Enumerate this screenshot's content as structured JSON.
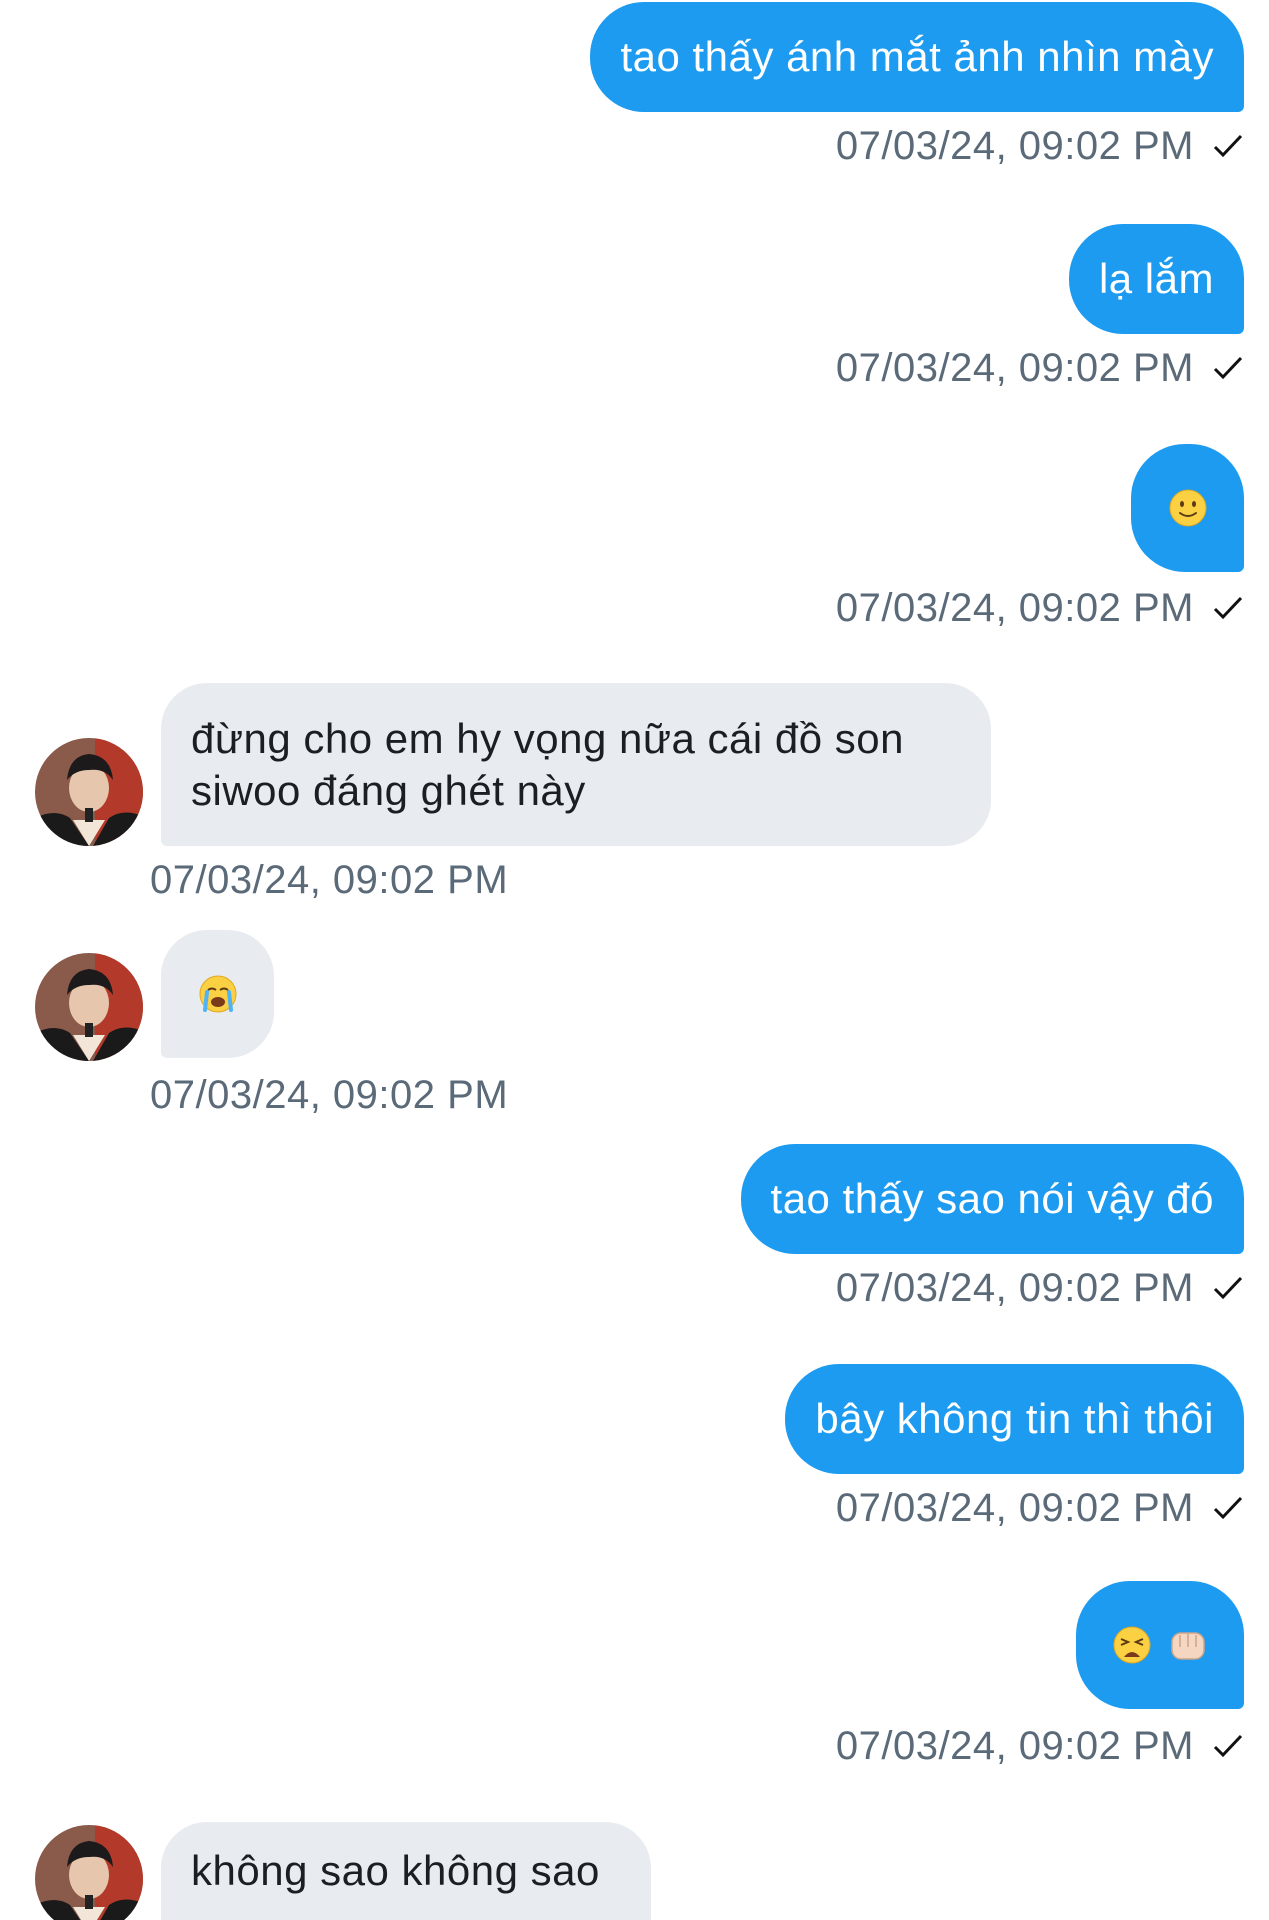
{
  "colors": {
    "outgoing_bubble": "#1d9bf0",
    "incoming_bubble": "#e8ebef",
    "timestamp": "#5b6a78"
  },
  "messages": [
    {
      "direction": "out",
      "text": "tao thấy ánh mắt ảnh nhìn mày",
      "timestamp": "07/03/24, 09:02 PM",
      "read_icon": "check-icon"
    },
    {
      "direction": "out",
      "text": "lạ lắm",
      "timestamp": "07/03/24, 09:02 PM",
      "read_icon": "check-icon"
    },
    {
      "direction": "out",
      "emoji": "slightly-smiling-face-emoji",
      "timestamp": "07/03/24, 09:02 PM",
      "read_icon": "check-icon"
    },
    {
      "direction": "in",
      "text_line1": "đừng cho em hy vọng nữa cái đồ son",
      "text_line2": "siwoo đáng ghét này",
      "timestamp": "07/03/24, 09:02 PM"
    },
    {
      "direction": "in",
      "emoji": "loudly-crying-face-emoji",
      "timestamp": "07/03/24, 09:02 PM"
    },
    {
      "direction": "out",
      "text": "tao thấy sao nói vậy đó",
      "timestamp": "07/03/24, 09:02 PM",
      "read_icon": "check-icon"
    },
    {
      "direction": "out",
      "text": "bây không tin thì thôi",
      "timestamp": "07/03/24, 09:02 PM",
      "read_icon": "check-icon"
    },
    {
      "direction": "out",
      "emoji": "weary-face-and-fist-emoji",
      "timestamp": "07/03/24, 09:02 PM",
      "read_icon": "check-icon"
    },
    {
      "direction": "in",
      "text": "không sao không sao"
    }
  ]
}
